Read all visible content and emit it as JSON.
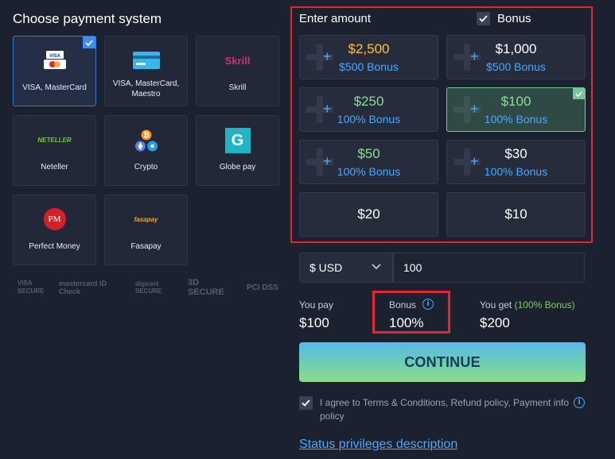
{
  "left_panel": {
    "title": "Choose payment system",
    "methods": [
      {
        "label": "VISA, MasterCard",
        "logo_text": "VISA"
      },
      {
        "label": "VISA, MasterCard, Maestro"
      },
      {
        "label": "Skrill",
        "logo_text": "Skrill"
      },
      {
        "label": "Neteller",
        "logo_text": "NETELLER"
      },
      {
        "label": "Crypto"
      },
      {
        "label": "Globe pay",
        "logo_text": "G"
      },
      {
        "label": "Perfect Money",
        "logo_text": "PM"
      },
      {
        "label": "Fasapay",
        "logo_text": "fasapay"
      }
    ],
    "security_logos": [
      "VISA SECURE",
      "mastercard ID Check",
      "digicert SECURE",
      "3D SECURE",
      "PCI DSS"
    ]
  },
  "amount_panel": {
    "title": "Enter amount",
    "bonus_label": "Bonus",
    "options": [
      {
        "amount": "$2,500",
        "bonus": "$500 Bonus",
        "color": "#f5c443"
      },
      {
        "amount": "$1,000",
        "bonus": "$500 Bonus",
        "color": "#ffffff"
      },
      {
        "amount": "$250",
        "bonus": "100% Bonus",
        "color": "#8fdc9a"
      },
      {
        "amount": "$100",
        "bonus": "100% Bonus",
        "color": "#8fdc9a"
      },
      {
        "amount": "$50",
        "bonus": "100% Bonus",
        "color": "#8fdc9a"
      },
      {
        "amount": "$30",
        "bonus": "100% Bonus",
        "color": "#ffffff"
      },
      {
        "amount": "$20"
      },
      {
        "amount": "$10"
      }
    ],
    "selected_option": "$100"
  },
  "form": {
    "currency": "$ USD",
    "amount_value": "100"
  },
  "summary": {
    "you_pay_label": "You pay",
    "you_pay_value": "$100",
    "bonus_label": "Bonus",
    "bonus_value": "100%",
    "you_get_label": "You get",
    "you_get_note": "(100% Bonus)",
    "you_get_value": "$200"
  },
  "continue_label": "CONTINUE",
  "agree_text": "I agree to Terms & Conditions, Refund policy, Payment info policy",
  "status_link": "Status privileges description",
  "colors": {
    "background": "#1c2130",
    "accent_blue": "#4aa8ff",
    "highlight_red": "#e3262f",
    "bonus_green": "#7dd34c"
  }
}
